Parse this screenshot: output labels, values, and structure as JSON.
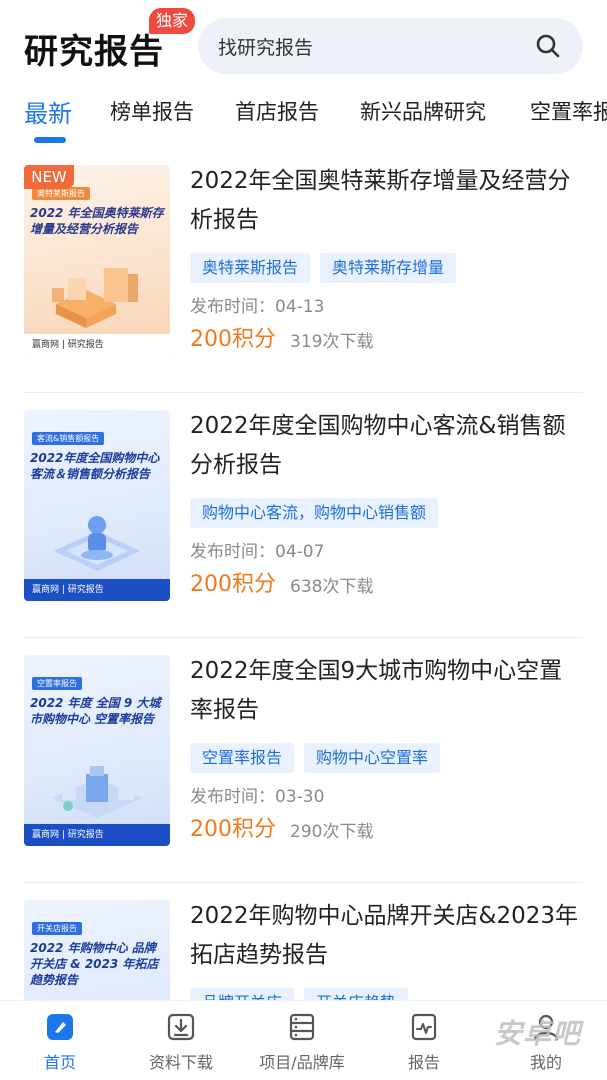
{
  "header": {
    "title": "研究报告",
    "badge": "独家",
    "search_text": "找研究报告"
  },
  "tabs": [
    {
      "label": "最新",
      "active": true
    },
    {
      "label": "榜单报告",
      "active": false
    },
    {
      "label": "首店报告",
      "active": false
    },
    {
      "label": "新兴品牌研究",
      "active": false
    },
    {
      "label": "空置率报告",
      "active": false
    }
  ],
  "reports": [
    {
      "title": "2022年全国奥特莱斯存增量及经营分析报告",
      "tags": [
        "奥特莱斯报告",
        "奥特莱斯存增量"
      ],
      "date": "发布时间：04-13",
      "price": "200积分",
      "downloads": "319次下载",
      "new_badge": "NEW",
      "thumb_tag": "奥特莱斯报告",
      "thumb_title": "2022 年全国奥特莱斯存增量及经营分析报告",
      "thumb_footer": "赢商网 | 研究报告"
    },
    {
      "title": "2022年度全国购物中心客流&销售额分析报告",
      "tags": [
        "购物中心客流，购物中心销售额"
      ],
      "date": "发布时间：04-07",
      "price": "200积分",
      "downloads": "638次下载",
      "thumb_tag": "客流&销售额报告",
      "thumb_title": "2022年度全国购物中心客流＆销售额分析报告",
      "thumb_footer": "赢商网 | 研究报告"
    },
    {
      "title": "2022年度全国9大城市购物中心空置率报告",
      "tags": [
        "空置率报告",
        "购物中心空置率"
      ],
      "date": "发布时间：03-30",
      "price": "200积分",
      "downloads": "290次下载",
      "thumb_tag": "空置率报告",
      "thumb_title": "2022 年度 全国 9 大城市购物中心 空置率报告",
      "thumb_footer": "赢商网 | 研究报告"
    },
    {
      "title": "2022年购物中心品牌开关店&2023年拓店趋势报告",
      "tags": [
        "品牌开关店",
        "开关店趋势"
      ],
      "thumb_tag": "开关店报告",
      "thumb_title": "2022 年购物中心 品牌开关店 & 2023 年拓店趋势报告",
      "thumb_footer": ""
    }
  ],
  "bottom_nav": [
    {
      "label": "首页",
      "icon": "home-icon",
      "active": true
    },
    {
      "label": "资料下载",
      "icon": "download-icon",
      "active": false
    },
    {
      "label": "项目/品牌库",
      "icon": "database-icon",
      "active": false
    },
    {
      "label": "报告",
      "icon": "report-icon",
      "active": false
    },
    {
      "label": "我的",
      "icon": "profile-icon",
      "active": false
    }
  ],
  "watermark": "安卓吧",
  "colors": {
    "accent": "#1c78e8",
    "price": "#f07a1e",
    "badge": "#f04a3e",
    "tag_bg": "#e8f1fd"
  }
}
